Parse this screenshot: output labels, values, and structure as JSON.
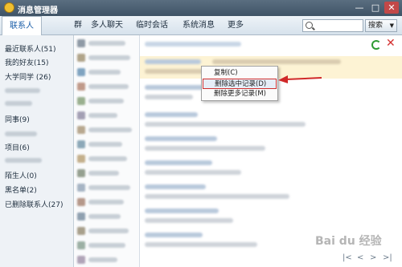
{
  "window": {
    "title": "消息管理器",
    "minimize": "—",
    "maximize": "□",
    "close": "✕"
  },
  "tabs": [
    {
      "label": "联系人",
      "active": true
    },
    {
      "label": "群"
    },
    {
      "label": "多人聊天"
    },
    {
      "label": "临时会话"
    },
    {
      "label": "系统消息"
    },
    {
      "label": "更多"
    }
  ],
  "search": {
    "placeholder": "",
    "button_label": "搜索",
    "dropdown_glyph": "▼"
  },
  "sidebar": {
    "items": [
      {
        "label": "最近联系人(51)"
      },
      {
        "label": "我的好友(15)"
      },
      {
        "label": "大学同学 (26)"
      },
      {
        "label": "同事(9)"
      },
      {
        "label": "项目(6)"
      },
      {
        "label": "陌生人(0)"
      },
      {
        "label": "黑名单(2)"
      },
      {
        "label": "已删除联系人(27)"
      }
    ]
  },
  "context_menu": {
    "items": [
      {
        "label": "复制(C)"
      },
      {
        "label": "删除选中记录(D)",
        "selected": true
      },
      {
        "label": "删除更多记录(M)"
      }
    ]
  },
  "pager": {
    "first": "|<",
    "prev": "<",
    "next": ">",
    "last": ">|"
  },
  "watermark": "Bai du 经验",
  "colors": {
    "titlebar": "#46596b",
    "accent_blue": "#1a5ea8",
    "highlight_row": "#fdf3d4",
    "selection_border": "#d03030",
    "refresh_icon": "#2e9a32",
    "delete_icon": "#d43030"
  }
}
